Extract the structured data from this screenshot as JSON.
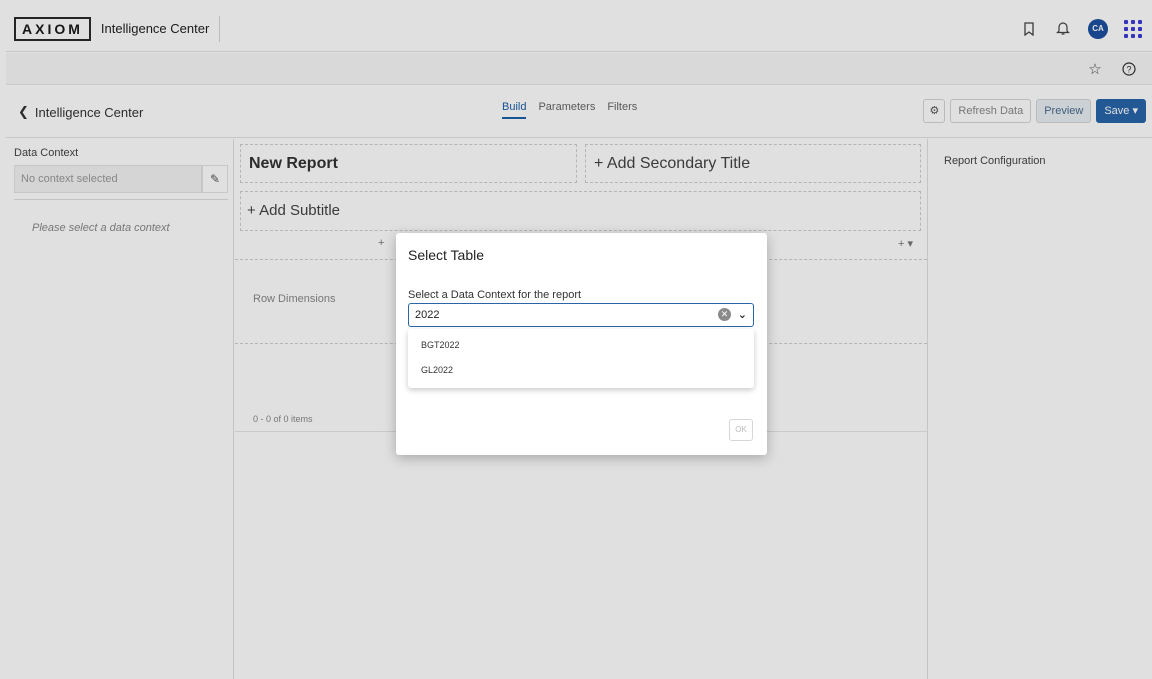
{
  "header": {
    "logo": "AXIOM",
    "app_name": "Intelligence Center",
    "avatar_initials": "CA",
    "icons": [
      "bookmark-icon",
      "bell-icon",
      "apps-grid-icon"
    ]
  },
  "subbar": {
    "icons": [
      "star-icon",
      "help-icon"
    ]
  },
  "nav": {
    "back_label": "Intelligence Center",
    "tabs": [
      {
        "label": "Build",
        "active": true
      },
      {
        "label": "Parameters",
        "active": false
      },
      {
        "label": "Filters",
        "active": false
      }
    ],
    "refresh_label": "Refresh Data",
    "preview_label": "Preview",
    "save_label": "Save"
  },
  "left_panel": {
    "label": "Data Context",
    "input_placeholder": "No context selected",
    "note": "Please select a data context"
  },
  "report": {
    "title": "New Report",
    "secondary_title": "+ Add Secondary Title",
    "subtitle": "+ Add Subtitle",
    "add_left": "+",
    "add_right": "+ ▾",
    "row_dimensions": "Row Dimensions",
    "items_count": "0 - 0 of 0 items"
  },
  "right_panel": {
    "title": "Report Configuration"
  },
  "modal": {
    "title": "Select Table",
    "label": "Select a Data Context for the report",
    "input_value": "2022",
    "options": [
      "BGT2022",
      "GL2022"
    ],
    "ok_label": "OK"
  },
  "colors": {
    "accent": "#2766a9",
    "avatar": "#1c4fa0",
    "apps_icon": "#3b3bd6"
  }
}
